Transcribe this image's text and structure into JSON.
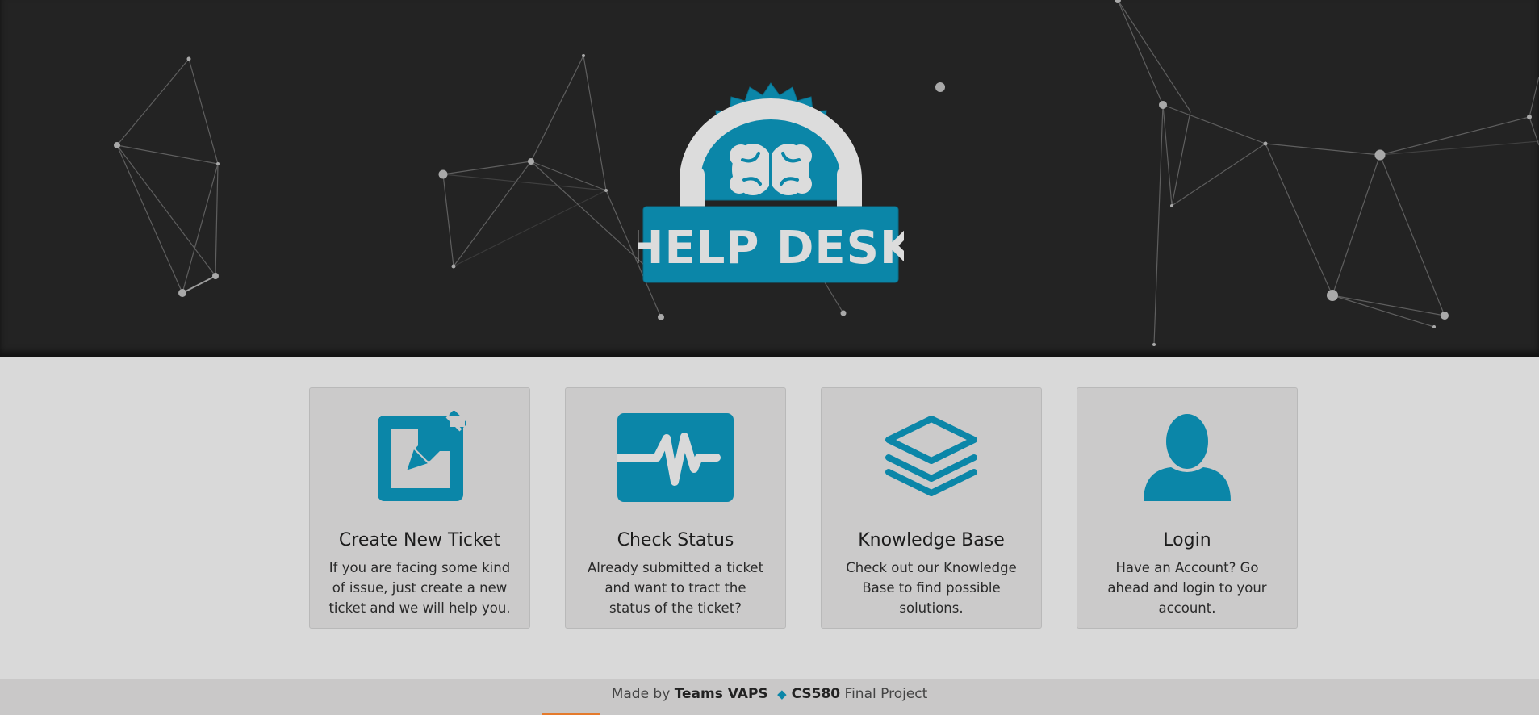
{
  "hero": {
    "logo_text": "HELP DESK",
    "logo_icon": "brain-headphones-icon"
  },
  "cards": [
    {
      "icon": "edit-square-icon",
      "title": "Create New Ticket",
      "description": "If you are facing some kind of issue, just create a new ticket and we will help you."
    },
    {
      "icon": "heartbeat-monitor-icon",
      "title": "Check Status",
      "description": "Already submitted a ticket and want to tract the status of the ticket?"
    },
    {
      "icon": "layers-stack-icon",
      "title": "Knowledge Base",
      "description": "Check out our Knowledge Base to find possible solutions."
    },
    {
      "icon": "user-icon",
      "title": "Login",
      "description": "Have an Account? Go ahead and login to your account."
    }
  ],
  "footer": {
    "prefix": "Made by",
    "team": "Teams VAPS",
    "course": "CS580",
    "suffix": "Final Project"
  },
  "colors": {
    "accent": "#0b86a8",
    "hero_bg": "#232323",
    "page_bg": "#d9d9d9",
    "card_bg": "#cbcaca"
  }
}
